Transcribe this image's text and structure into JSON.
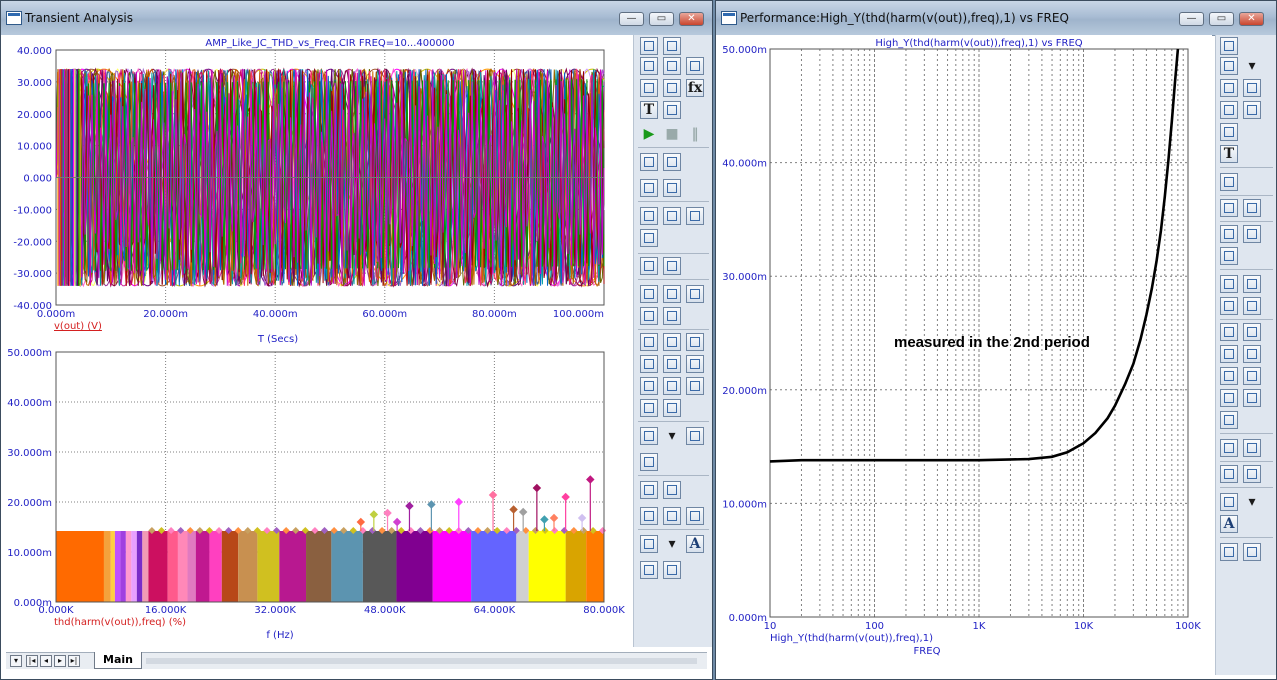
{
  "transient_window": {
    "title": "Transient Analysis",
    "caption_buttons": [
      "minimize",
      "restore",
      "close"
    ],
    "graph": {
      "title": "AMP_Like_JC_THD_vs_Freq.CIR FREQ=10...400000"
    },
    "sheet_tab": "Main",
    "nav_buttons": [
      "first",
      "previous",
      "next",
      "last"
    ]
  },
  "performance_window": {
    "title": "Performance:High_Y(thd(harm(v(out)),freq),1) vs FREQ",
    "caption_buttons": [
      "minimize",
      "restore",
      "close"
    ],
    "annotation": "measured in the 2nd period"
  },
  "colors": {
    "window_frame": "#6e8aa6",
    "plot_text": "#1f1fc4",
    "expression_label": "#d42020",
    "grid": "#808080",
    "performance_curve": "#000000",
    "close_button": "#c9452e"
  },
  "chart_data": [
    {
      "type": "line",
      "title": "AMP_Like_JC_THD_vs_Freq.CIR FREQ=10...400000",
      "xlabel": "T (Secs)",
      "ylabel": "v(out) (V)",
      "x_ticks": [
        "0.000m",
        "20.000m",
        "40.000m",
        "60.000m",
        "80.000m",
        "100.000m"
      ],
      "y_ticks": [
        "40.000",
        "30.000",
        "20.000",
        "10.000",
        "0.000",
        "-10.000",
        "-20.000",
        "-30.000",
        "-40.000"
      ],
      "xlim": [
        0,
        0.1
      ],
      "ylim": [
        -40,
        40
      ],
      "grid": true,
      "series_description": "family of sine waves of amplitude about 34 V, one per stepped frequency",
      "amplitude": 34,
      "lowest_visible_period": 0.035
    },
    {
      "type": "bar",
      "xlabel": "f (Hz)",
      "ylabel": "thd(harm(v(out)),freq) (%)",
      "x_ticks": [
        "0.000K",
        "16.000K",
        "32.000K",
        "48.000K",
        "64.000K",
        "80.000K"
      ],
      "y_ticks": [
        "50.000m",
        "40.000m",
        "30.000m",
        "20.000m",
        "10.000m",
        "0.000m"
      ],
      "xlim": [
        0,
        80000
      ],
      "ylim": [
        0,
        0.05
      ],
      "grid": true,
      "base_level": 0.0142,
      "bands": [
        {
          "from": 0,
          "to": 7000,
          "color": "#ff6a00"
        },
        {
          "from": 7000,
          "to": 8000,
          "color": "#f4a23c"
        },
        {
          "from": 8000,
          "to": 8600,
          "color": "#ffd040"
        },
        {
          "from": 8600,
          "to": 9400,
          "color": "#c050ff"
        },
        {
          "from": 9400,
          "to": 10200,
          "color": "#a040e0"
        },
        {
          "from": 10200,
          "to": 11000,
          "color": "#ff9ad0"
        },
        {
          "from": 11000,
          "to": 11800,
          "color": "#e8a0ff"
        },
        {
          "from": 11800,
          "to": 12600,
          "color": "#7a2cc8"
        },
        {
          "from": 12600,
          "to": 13500,
          "color": "#f29ab5"
        },
        {
          "from": 13500,
          "to": 16300,
          "color": "#cc1060"
        },
        {
          "from": 16300,
          "to": 17800,
          "color": "#ff5a8c"
        },
        {
          "from": 17800,
          "to": 19200,
          "color": "#ff88b8"
        },
        {
          "from": 19200,
          "to": 20400,
          "color": "#e07ac0"
        },
        {
          "from": 20400,
          "to": 22400,
          "color": "#c01890"
        },
        {
          "from": 22400,
          "to": 24200,
          "color": "#ff40c0"
        },
        {
          "from": 24200,
          "to": 26600,
          "color": "#b84818"
        },
        {
          "from": 26600,
          "to": 29400,
          "color": "#c89050"
        },
        {
          "from": 29400,
          "to": 32600,
          "color": "#d0c020"
        },
        {
          "from": 32600,
          "to": 36500,
          "color": "#b81890"
        },
        {
          "from": 36500,
          "to": 40200,
          "color": "#8a6040"
        },
        {
          "from": 40200,
          "to": 44800,
          "color": "#5c94b0"
        },
        {
          "from": 44800,
          "to": 49700,
          "color": "#585858"
        },
        {
          "from": 49700,
          "to": 55000,
          "color": "#800090"
        },
        {
          "from": 55000,
          "to": 60600,
          "color": "#ff00ff"
        },
        {
          "from": 60600,
          "to": 67200,
          "color": "#6464ff"
        },
        {
          "from": 67200,
          "to": 69000,
          "color": "#d0d0d0"
        },
        {
          "from": 69000,
          "to": 74400,
          "color": "#ffff00"
        },
        {
          "from": 74400,
          "to": 77400,
          "color": "#d9a400"
        },
        {
          "from": 77400,
          "to": 80000,
          "color": "#ff7a00"
        }
      ],
      "stems": [
        {
          "x": 44500,
          "y": 0.016,
          "color": "#ff6a40"
        },
        {
          "x": 46400,
          "y": 0.0175,
          "color": "#c0d040"
        },
        {
          "x": 48400,
          "y": 0.0178,
          "color": "#ff80c0"
        },
        {
          "x": 49800,
          "y": 0.016,
          "color": "#d040d0"
        },
        {
          "x": 51600,
          "y": 0.0192,
          "color": "#a020a0"
        },
        {
          "x": 54800,
          "y": 0.0195,
          "color": "#5c94b0"
        },
        {
          "x": 58800,
          "y": 0.02,
          "color": "#ff40ff"
        },
        {
          "x": 63800,
          "y": 0.0214,
          "color": "#ff70a0"
        },
        {
          "x": 66800,
          "y": 0.0185,
          "color": "#b86030"
        },
        {
          "x": 68200,
          "y": 0.018,
          "color": "#a0a0a0"
        },
        {
          "x": 70200,
          "y": 0.0228,
          "color": "#a01060"
        },
        {
          "x": 71300,
          "y": 0.0165,
          "color": "#40a0b0"
        },
        {
          "x": 72700,
          "y": 0.0168,
          "color": "#ff8060"
        },
        {
          "x": 74400,
          "y": 0.021,
          "color": "#ff40a0"
        },
        {
          "x": 76800,
          "y": 0.0168,
          "color": "#d0c0f0"
        },
        {
          "x": 78000,
          "y": 0.0245,
          "color": "#c01880"
        }
      ]
    },
    {
      "type": "line",
      "title": "High_Y(thd(harm(v(out)),freq),1) vs FREQ",
      "xlabel": "FREQ",
      "ylabel": "High_Y(thd(harm(v(out)),freq),1)",
      "xscale": "log",
      "x_ticks": [
        "10",
        "100",
        "1K",
        "10K",
        "100K"
      ],
      "y_ticks": [
        "50.000m",
        "40.000m",
        "30.000m",
        "20.000m",
        "10.000m",
        "0.000m"
      ],
      "xlim": [
        10,
        100000
      ],
      "ylim": [
        0,
        0.05
      ],
      "grid": true,
      "series": [
        {
          "x": [
            10,
            20,
            50,
            100,
            300,
            1000,
            3000,
            5000,
            7000,
            10000,
            13000,
            17000,
            20000,
            25000,
            30000,
            35000,
            40000,
            45000,
            50000,
            55000,
            60000,
            65000,
            70000,
            75000,
            80000
          ],
          "y": [
            0.0137,
            0.0138,
            0.0138,
            0.0138,
            0.0138,
            0.0138,
            0.0139,
            0.0141,
            0.0145,
            0.0153,
            0.0162,
            0.0175,
            0.0186,
            0.0205,
            0.0223,
            0.0244,
            0.0266,
            0.0289,
            0.0313,
            0.034,
            0.037,
            0.0402,
            0.0436,
            0.047,
            0.05
          ]
        }
      ]
    }
  ]
}
